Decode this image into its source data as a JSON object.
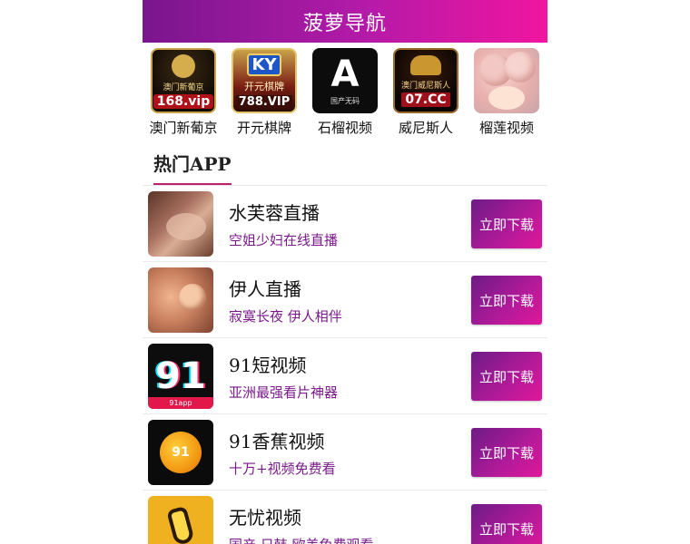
{
  "header": {
    "title": "菠萝导航"
  },
  "top_apps": [
    {
      "label": "澳门新葡京",
      "icon": "macau-casino-icon",
      "art_text1": "澳门新葡京",
      "art_text2": "168.vip"
    },
    {
      "label": "开元棋牌",
      "icon": "ky-chess-icon",
      "art_logo": "KY",
      "art_text1": "开元棋牌",
      "art_text2": "788.VIP"
    },
    {
      "label": "石榴视频",
      "icon": "letter-a-icon",
      "art_big": "A",
      "art_small": "国产无码"
    },
    {
      "label": "威尼斯人",
      "icon": "venetian-icon",
      "art_text1": "澳门威尼斯人",
      "art_text2": "07.CC"
    },
    {
      "label": "榴莲视频",
      "icon": "durian-video-icon"
    }
  ],
  "section": {
    "title": "热门APP"
  },
  "apps": [
    {
      "name": "水芙蓉直播",
      "desc": "空姐少妇在线直播",
      "button": "立即下载",
      "icon": "shuifurong-thumb-icon"
    },
    {
      "name": "伊人直播",
      "desc": "寂寞长夜 伊人相伴",
      "button": "立即下载",
      "icon": "yiren-thumb-icon"
    },
    {
      "name": "91短视频",
      "desc": "亚洲最强看片神器",
      "button": "立即下载",
      "icon": "91-short-video-icon",
      "art_num": "91",
      "art_bar": "91app"
    },
    {
      "name": "91香蕉视频",
      "desc": "十万+视频免费看",
      "button": "立即下载",
      "icon": "91-banana-icon",
      "art_num": "91"
    },
    {
      "name": "无忧视频",
      "desc": "国产 日韩 欧美免费观看",
      "button": "立即下载",
      "icon": "banana-icon"
    }
  ],
  "colors": {
    "header_start": "#7a168e",
    "header_end": "#f015a0",
    "accent": "#c01f6e",
    "desc_text": "#7a1a8a"
  }
}
